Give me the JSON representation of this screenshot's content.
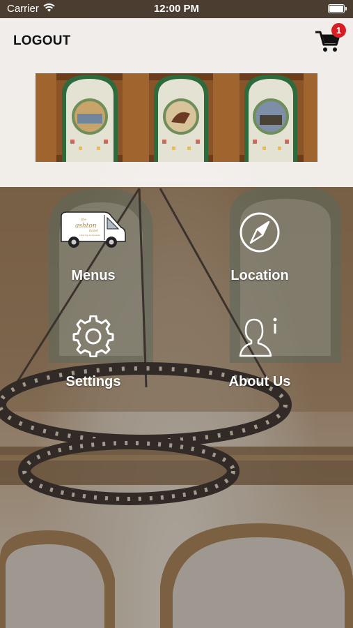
{
  "status_bar": {
    "carrier": "Carrier",
    "time": "12:00 PM"
  },
  "header": {
    "logout_label": "LOGOUT",
    "cart_badge_count": "1",
    "banner_alt": "stained glass windows"
  },
  "van_logo": {
    "line1": "the",
    "line2": "ashton",
    "line3": "hotel",
    "line4": "catering and events"
  },
  "menu": {
    "items": [
      {
        "label": "Menus",
        "icon": "van-icon"
      },
      {
        "label": "Location",
        "icon": "compass-icon"
      },
      {
        "label": "Settings",
        "icon": "gear-icon"
      },
      {
        "label": "About Us",
        "icon": "person-info-icon"
      }
    ]
  },
  "colors": {
    "badge": "#d81e23",
    "text_light": "#ffffff",
    "header_bg": "#f5f3f0"
  }
}
